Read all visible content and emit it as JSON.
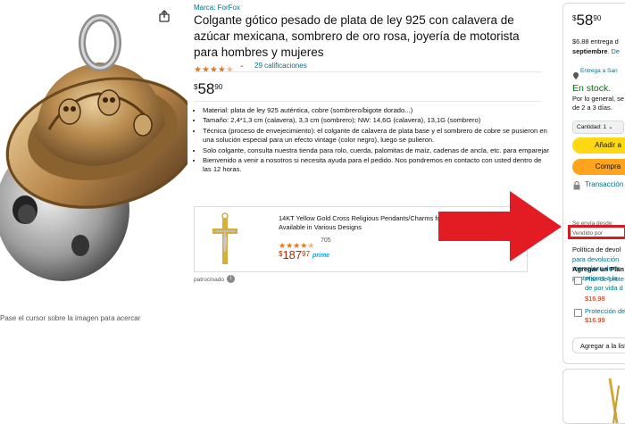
{
  "product": {
    "brand": "Marca: ForFox",
    "title": "Colgante gótico pesado de plata de ley 925 con calavera de azúcar mexicana, sombrero de oro rosa, joyería de motorista para hombres y mujeres",
    "rating": 4.5,
    "ratings_text": "29 calificaciones",
    "price_symbol": "$",
    "price_whole": "58",
    "price_fraction": "90",
    "bullets": [
      "Material: plata de ley 925 auténtica, cobre (sombrero/bigote dorado...)",
      "Tamaño: 2,4*1,3 cm (calavera), 3,3 cm (sombrero); NW: 14,6G (calavera), 13,1G (sombrero)",
      "Técnica (proceso de envejecimiento): el colgante de calavera de plata base y el sombrero de cobre se pusieron en una solución especial para un efecto vintage (color negro), luego se pulieron.",
      "Solo colgante, consulta nuestra tienda para rolo, cuerda, palomitas de maíz, cadenas de ancla, etc. para emparejar",
      "Bienvenido a venir a nosotros si necesita ayuda para el pedido. Nos pondremos en contacto con usted dentro de las 12 horas."
    ],
    "zoom_hint": "Pase el cursor sobre la imagen para acercar"
  },
  "sponsored": {
    "title": "14KT Yellow Gold Cross Religious Pendants/Charms fo... Available in Various Designs",
    "rating": 4.5,
    "review_count": "705",
    "price_symbol": "$",
    "price_whole": "187",
    "price_fraction": "97",
    "prime": "prime",
    "label": "patrocinado"
  },
  "buybox": {
    "price_symbol": "$",
    "price_whole": "58",
    "price_fraction": "90",
    "delivery_line1": "$6.88 entrega d",
    "delivery_date": "septiembre",
    "delivery_more": ". De",
    "location": "Entrega a San",
    "stock": "En stock.",
    "general_line1": "Por lo general, se",
    "general_line2": "de 2 a 3 días.",
    "quantity_label": "Cantidad: 1",
    "add_to_cart": "Añadir a",
    "buy_now": "Compra",
    "secure": "Transacción",
    "ships_from": "Se envía desde",
    "sold_by": "Vendido por",
    "returns_l1": "Política de devol",
    "returns_l2": "para devolución",
    "returns_l3": "reemplazo dentr",
    "returns_l4": "posteriores a la",
    "plan_header": "Agregar un Plan",
    "plan1_l1": "Plan de prote",
    "plan1_l2": "de por vida d",
    "plan1_price": "$16.98",
    "plan2_l1": "Protección de",
    "plan2_price": "$16.99",
    "add_to_list": "Agregar a la list"
  },
  "colors": {
    "accent_link": "#007185",
    "add_to_cart": "#ffd814",
    "buy_now": "#ffa41c",
    "highlight": "#d71920",
    "in_stock": "#007600",
    "price_red": "#b12704",
    "stars": "#de7921"
  },
  "icons": [
    "share-icon",
    "chevron-down-icon",
    "location-pin-icon",
    "lock-icon",
    "info-icon",
    "checkbox-icon"
  ]
}
